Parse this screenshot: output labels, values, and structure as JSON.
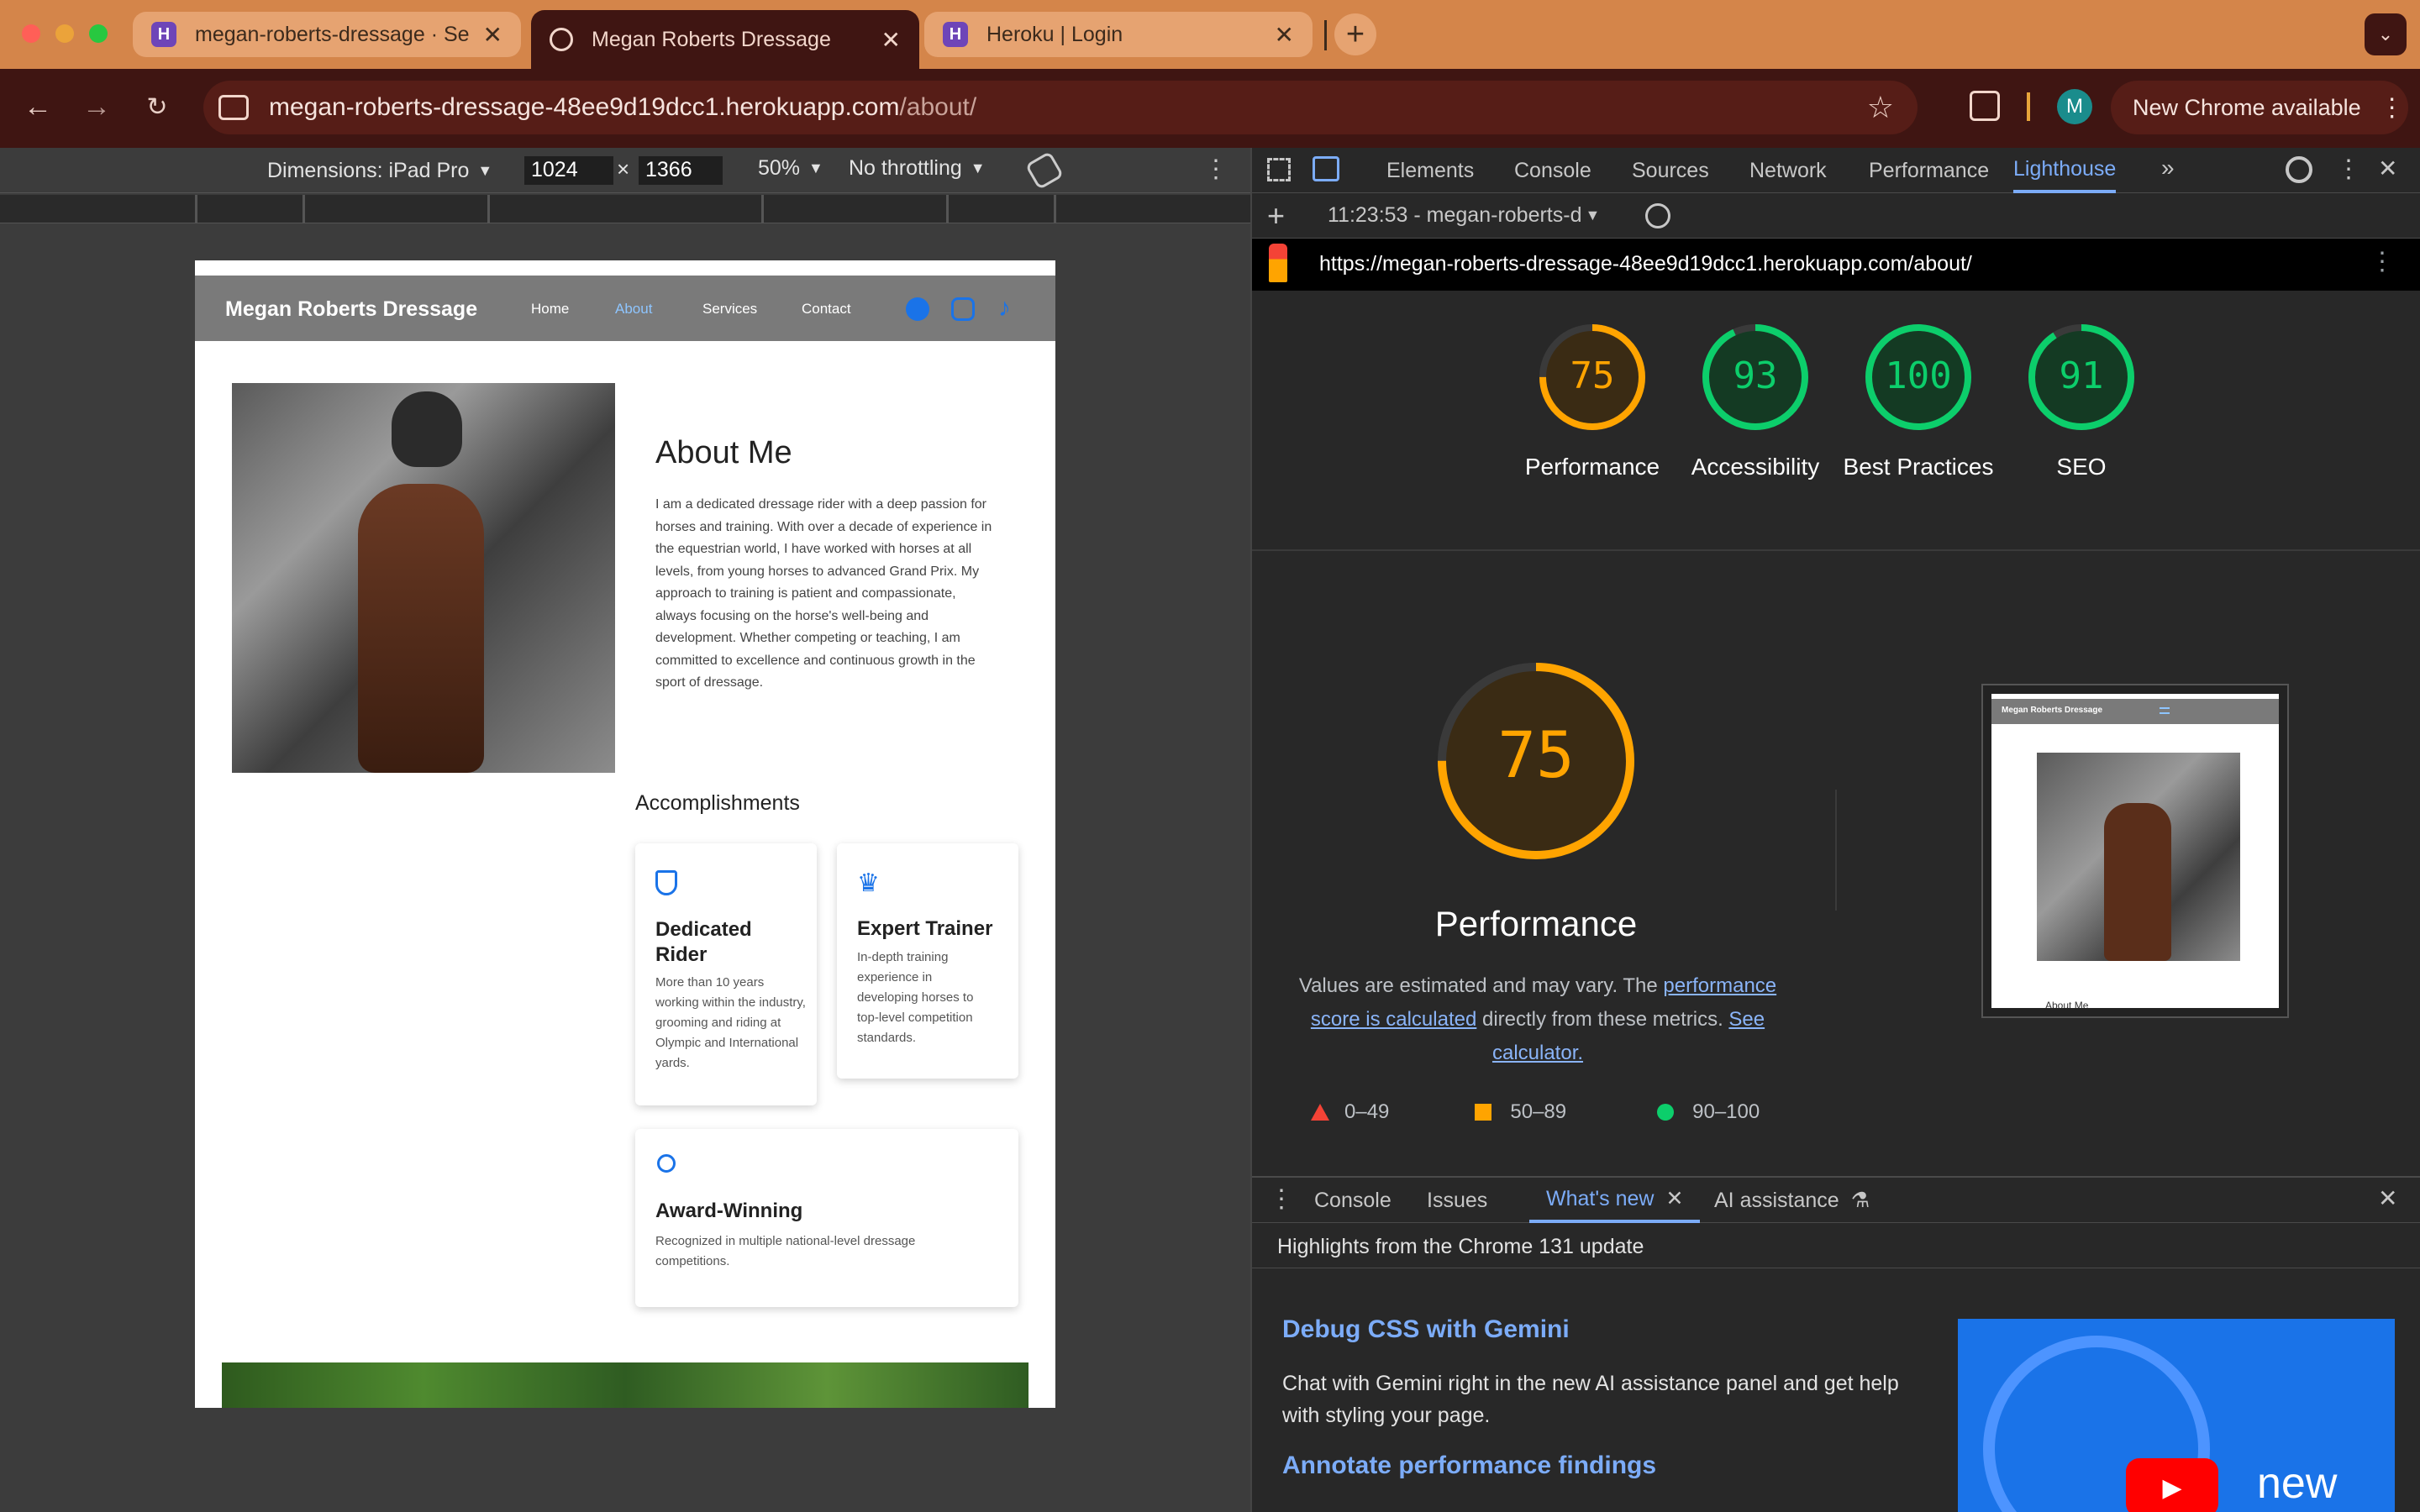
{
  "browser": {
    "tabs": [
      {
        "title": "megan-roberts-dressage · Se"
      },
      {
        "title": "Megan Roberts Dressage"
      },
      {
        "title": "Heroku | Login"
      }
    ],
    "tab_favicon": "H",
    "url_host": "megan-roberts-dressage-48ee9d19dcc1.herokuapp.com",
    "url_path": "/about/",
    "profile_initial": "M",
    "update_label": "New Chrome available"
  },
  "device_toolbar": {
    "dimensions_label": "Dimensions: iPad Pro",
    "width": "1024",
    "height": "1366",
    "times": "×",
    "zoom": "50%",
    "throttling": "No throttling"
  },
  "site": {
    "brand": "Megan Roberts Dressage",
    "nav": [
      "Home",
      "About",
      "Services",
      "Contact"
    ],
    "about_heading": "About Me",
    "about_text": "I am a dedicated dressage rider with a deep passion for horses and training. With over a decade of experience in the equestrian world, I have worked with horses at all levels, from young horses to advanced Grand Prix. My approach to training is patient and compassionate, always focusing on the horse's well-being and development. Whether competing or teaching, I am committed to excellence and continuous growth in the sport of dressage.",
    "accomplishments_heading": "Accomplishments",
    "cards": [
      {
        "title": "Dedicated Rider",
        "text": "More than 10 years working within the industry, grooming and riding at Olympic and International yards.",
        "icon": "shield-check-icon"
      },
      {
        "title": "Expert Trainer",
        "text": "In-depth training experience in developing horses to top-level competition standards.",
        "icon": "trophy-icon"
      },
      {
        "title": "Award-Winning",
        "text": "Recognized in multiple national-level dressage competitions.",
        "icon": "award-ribbon-icon"
      }
    ]
  },
  "devtools": {
    "tabs": [
      "Elements",
      "Console",
      "Sources",
      "Network",
      "Performance",
      "Lighthouse"
    ],
    "report_select": "11:23:53 - megan-roberts-d",
    "report_url": "https://megan-roberts-dressage-48ee9d19dcc1.herokuapp.com/about/",
    "scores": [
      {
        "value": "75",
        "label": "Performance",
        "color": "#ffa400",
        "fraction": 0.75
      },
      {
        "value": "93",
        "label": "Accessibility",
        "color": "#0cce6b",
        "fraction": 0.93
      },
      {
        "value": "100",
        "label": "Best Practices",
        "color": "#0cce6b",
        "fraction": 1.0
      },
      {
        "value": "91",
        "label": "SEO",
        "color": "#0cce6b",
        "fraction": 0.91
      }
    ],
    "perf_big_score": "75",
    "perf_title": "Performance",
    "perf_desc_1": "Values are estimated and may vary. The ",
    "perf_link_1": "performance score is calculated",
    "perf_desc_2": " directly from these metrics. ",
    "perf_link_2": "See calculator.",
    "legend": [
      "0–49",
      "50–89",
      "90–100"
    ],
    "thumb_brand": "Megan Roberts Dressage",
    "thumb_heading": "About Me",
    "drawer_tabs": [
      "Console",
      "Issues",
      "What's new",
      "AI assistance"
    ],
    "drawer_highlight": "Highlights from the Chrome 131 update",
    "whatsnew_h1": "Debug CSS with Gemini",
    "whatsnew_p1": "Chat with Gemini right in the new AI assistance panel and get help with styling your page.",
    "whatsnew_h2": "Annotate performance findings",
    "video_label": "new"
  },
  "colors": {
    "accent_blue": "#1a73e8",
    "tab_orange": "#d4854a",
    "toolbar_brown": "#3f1512"
  }
}
